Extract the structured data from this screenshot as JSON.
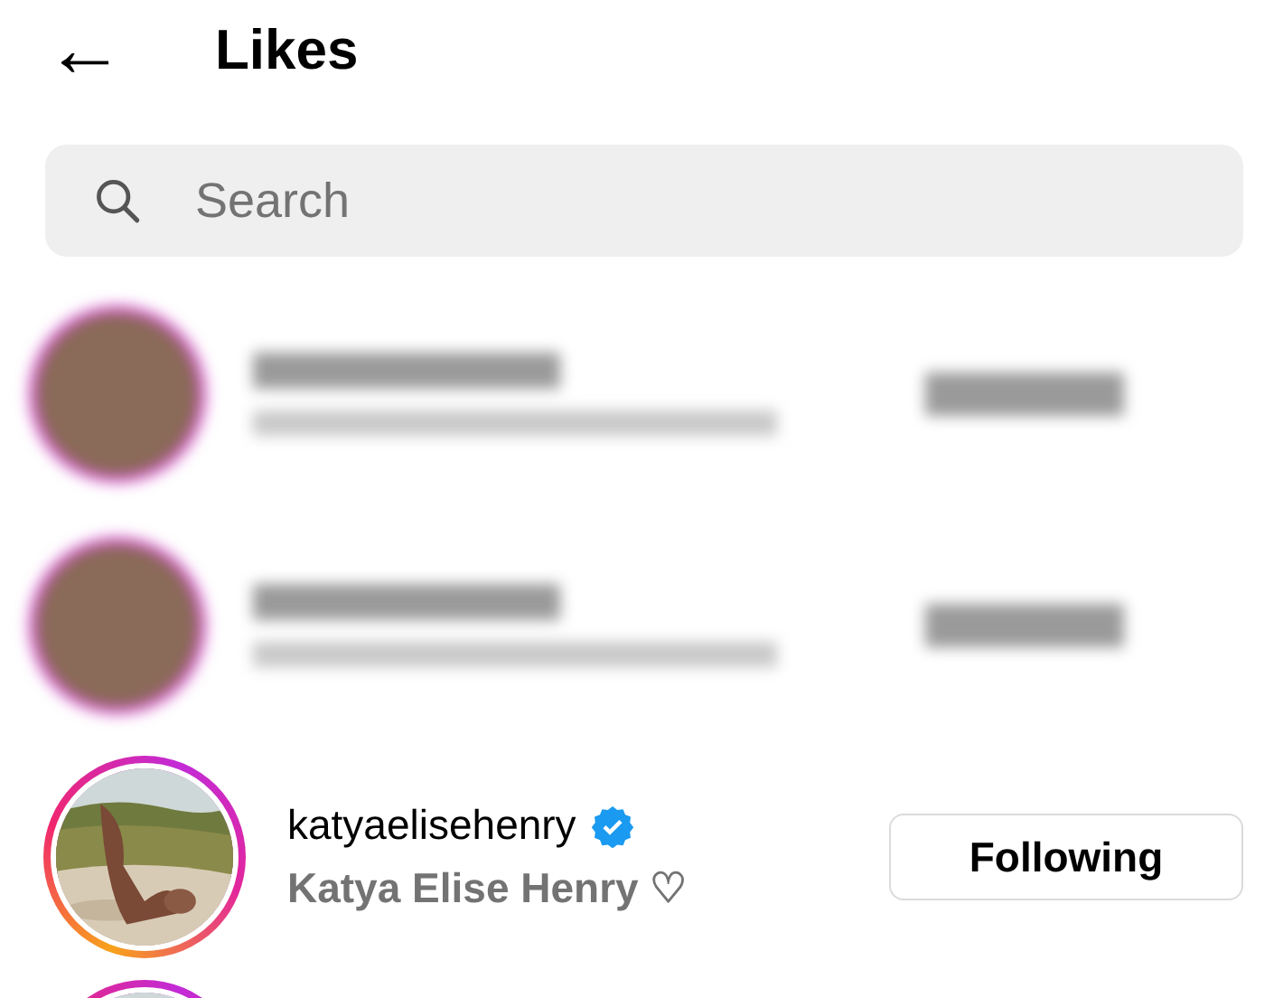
{
  "header": {
    "back_icon": "←",
    "title": "Likes"
  },
  "search": {
    "placeholder": "Search"
  },
  "rows": [
    {
      "kind": "blurred",
      "story_ring": true
    },
    {
      "kind": "blurred",
      "story_ring": true
    },
    {
      "kind": "account",
      "story_ring": true,
      "username": "katyaelisehenry",
      "verified": true,
      "full_name": "Katya Elise Henry ♡",
      "button": "Following"
    },
    {
      "kind": "partial",
      "story_ring": true
    }
  ]
}
